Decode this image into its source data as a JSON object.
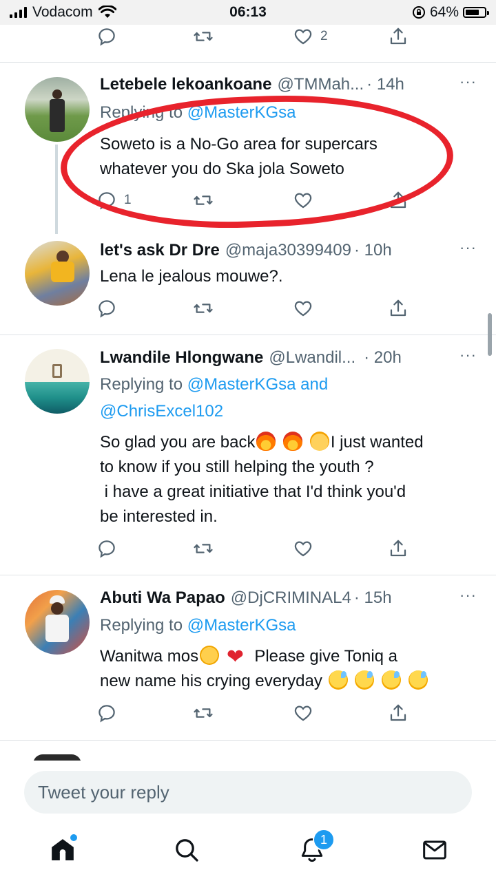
{
  "status_bar": {
    "carrier": "Vodacom",
    "time": "06:13",
    "battery_percent": "64%",
    "battery_level": 0.64
  },
  "top_actions": {
    "like_count": "2"
  },
  "tweets": [
    {
      "name": "Letebele lekoankoane",
      "handle": "@TMMah...",
      "time": "· 14h",
      "replying_prefix": "Replying to",
      "replying_to": "@MasterKGsa",
      "text_lines": [
        "Soweto is a No-Go area for supercars",
        "whatever you do Ska jola Soweto"
      ],
      "reply_count": "1"
    },
    {
      "name": "let's ask Dr Dre",
      "handle": "@maja30399409",
      "time": "· 10h",
      "text": "Lena le jealous mouwe?."
    },
    {
      "name": "Lwandile Hlongwane",
      "handle": "@Lwandil...",
      "time": "· 20h",
      "replying_prefix": "Replying to",
      "replying_to": "@MasterKGsa and",
      "replying_to_2": "@ChrisExcel102",
      "line1_a": "So glad you are back",
      "line1_b": "I just wanted",
      "line2": "to know if you still helping the youth ?",
      "line3": " i have a great initiative that I'd think you'd",
      "line4": "be interested in."
    },
    {
      "name": "Abuti Wa Papao",
      "handle": "@DjCRIMINAL4",
      "time": "· 15h",
      "replying_prefix": "Replying to",
      "replying_to": "@MasterKGsa",
      "line1_a": "Wanitwa mos",
      "line1_b": "Please give Toniq a",
      "line2": "new name his crying everyday"
    }
  ],
  "more_label": "···",
  "reply_placeholder": "Tweet your reply",
  "nav": {
    "notifications_badge": "1"
  },
  "colors": {
    "accent": "#1d9bf0",
    "annotation": "#e8232c",
    "muted": "#536471"
  }
}
